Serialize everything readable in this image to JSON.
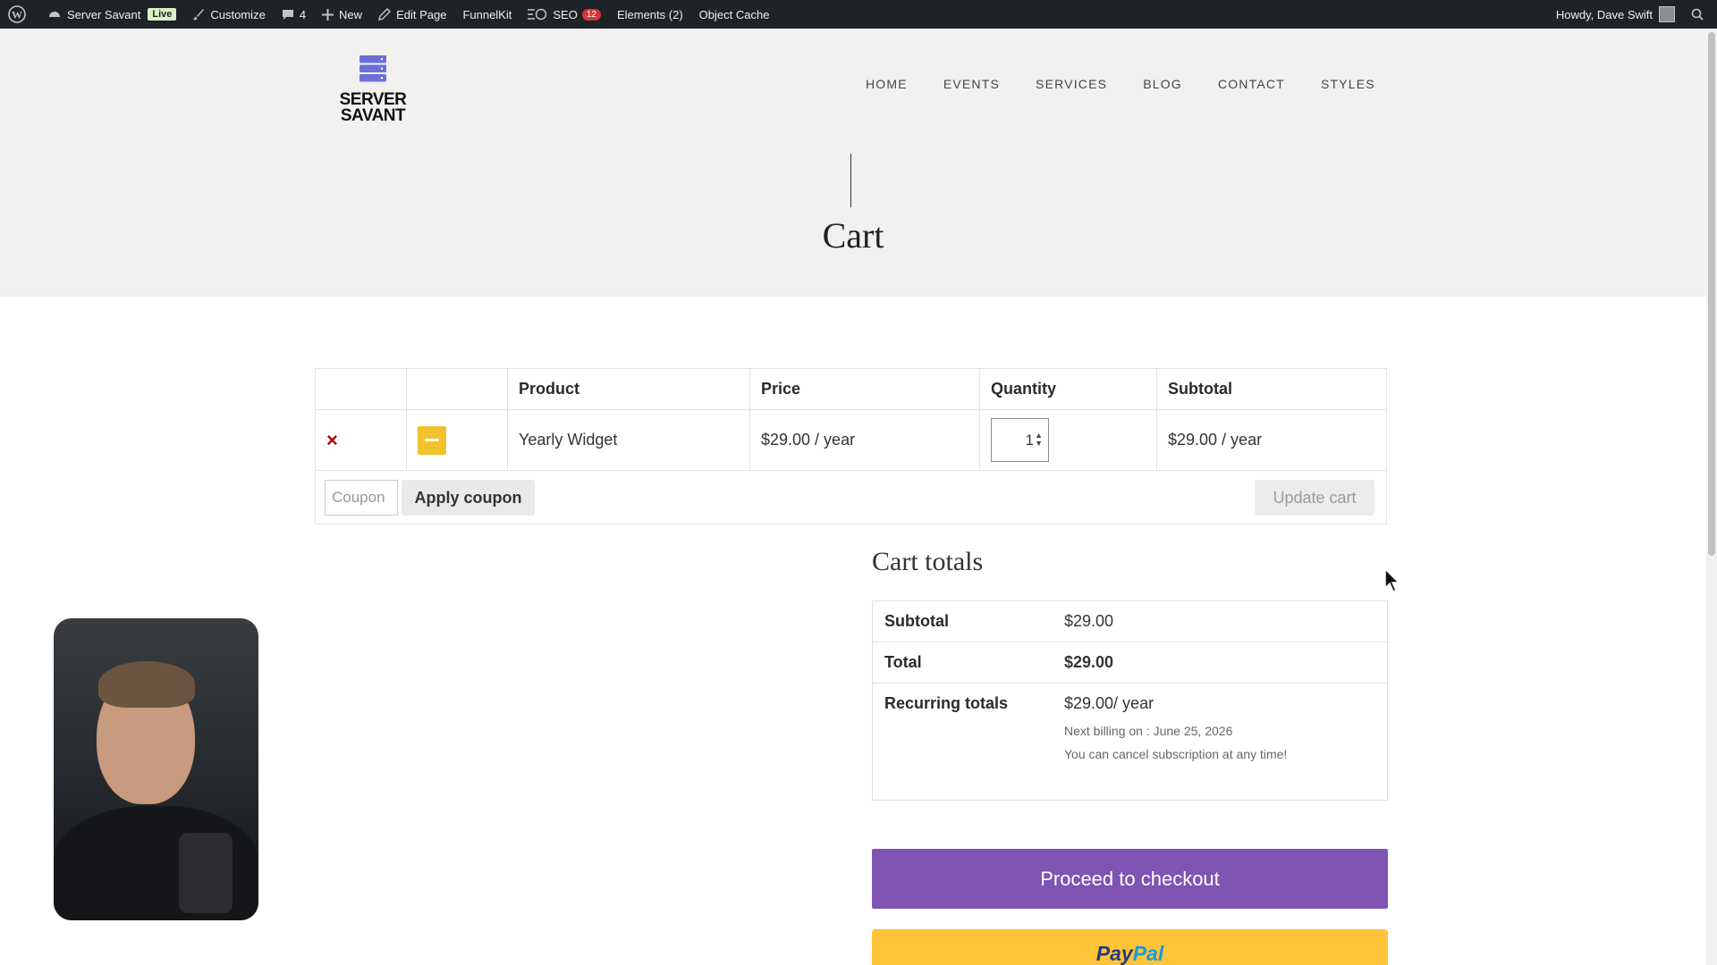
{
  "adminbar": {
    "site_name": "Server Savant",
    "live_badge": "Live",
    "customize": "Customize",
    "comments_count": "4",
    "new": "New",
    "edit_page": "Edit Page",
    "funnelkit": "FunnelKit",
    "seo": "SEO",
    "seo_count": "12",
    "elements": "Elements (2)",
    "object_cache": "Object Cache",
    "howdy": "Howdy, Dave Swift"
  },
  "site": {
    "logo_line1": "SERVER",
    "logo_line2": "SAVANT",
    "nav": [
      "HOME",
      "EVENTS",
      "SERVICES",
      "BLOG",
      "CONTACT",
      "STYLES"
    ],
    "page_title": "Cart"
  },
  "cart": {
    "columns": [
      "",
      "",
      "Product",
      "Price",
      "Quantity",
      "Subtotal"
    ],
    "items": [
      {
        "remove": "×",
        "product": "Yearly Widget",
        "price": "$29.00 / year",
        "quantity": "1",
        "subtotal": "$29.00 / year"
      }
    ],
    "coupon_placeholder": "Coupon",
    "apply_coupon": "Apply coupon",
    "update_cart": "Update cart"
  },
  "totals": {
    "title": "Cart totals",
    "subtotal_label": "Subtotal",
    "subtotal_value": "$29.00",
    "total_label": "Total",
    "total_value": "$29.00",
    "recurring_label": "Recurring totals",
    "recurring_value": "$29.00/ year",
    "next_billing": "Next billing on : June 25, 2026",
    "cancel_note": "You can cancel subscription at any time!",
    "checkout_button": "Proceed to checkout",
    "paypal_pay": "Pay",
    "paypal_pal": "Pal"
  },
  "colors": {
    "admin_bar": "#1d2327",
    "checkout": "#7f54b3",
    "paypal": "#ffc439",
    "remove": "#aa0000",
    "logo_icon": "#6c6fd8"
  },
  "icons": [
    "wordpress-icon",
    "dashboard-icon",
    "brush-icon",
    "comment-icon",
    "plus-icon",
    "pencil-icon",
    "seo-icon",
    "search-icon",
    "server-logo-icon",
    "remove-icon",
    "cursor-icon"
  ]
}
